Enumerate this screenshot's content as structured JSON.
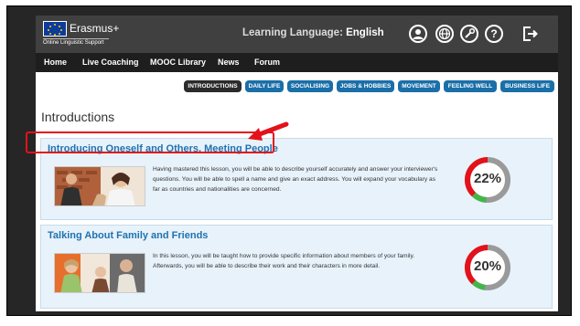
{
  "header": {
    "brand": "Erasmus+",
    "brand_sub": "Online Linguistic Support",
    "lang_prefix": "Learning Language:",
    "lang_value": "English",
    "icons": [
      "user-icon",
      "globe-icon",
      "wrench-icon",
      "help-icon",
      "logout-icon"
    ]
  },
  "nav": [
    "Home",
    "Live Coaching",
    "MOOC Library",
    "News",
    "Forum"
  ],
  "filters": [
    "INTRODUCTIONS",
    "DAILY LIFE",
    "SOCIALISING",
    "JOBS & HOBBIES",
    "MOVEMENT",
    "FEELING WELL",
    "BUSINESS LIFE"
  ],
  "section_title": "Introductions",
  "lessons": [
    {
      "title": "Introducing Oneself and Others, Meeting People",
      "description": "Having mastered this lesson, you will be able to describe yourself accurately and answer your interviewer's questions. You will be able to spell a name and give an exact address. You will expand your vocabulary as far as countries and nationalities are concerned.",
      "progress_label": "22%",
      "progress": 0.22
    },
    {
      "title": "Talking About Family and Friends",
      "description": "In this lesson, you will be taught how to provide specific information about members of your family. Afterwards, you will be able to describe their work and their characters in more detail.",
      "progress_label": "20%",
      "progress": 0.2
    }
  ],
  "colors": {
    "accent": "#1f72b0",
    "pill": "#1a6fa8",
    "highlight": "#e3121a",
    "ring_red": "#e3121a",
    "ring_green": "#43b649",
    "ring_grey": "#9a9a9a"
  }
}
